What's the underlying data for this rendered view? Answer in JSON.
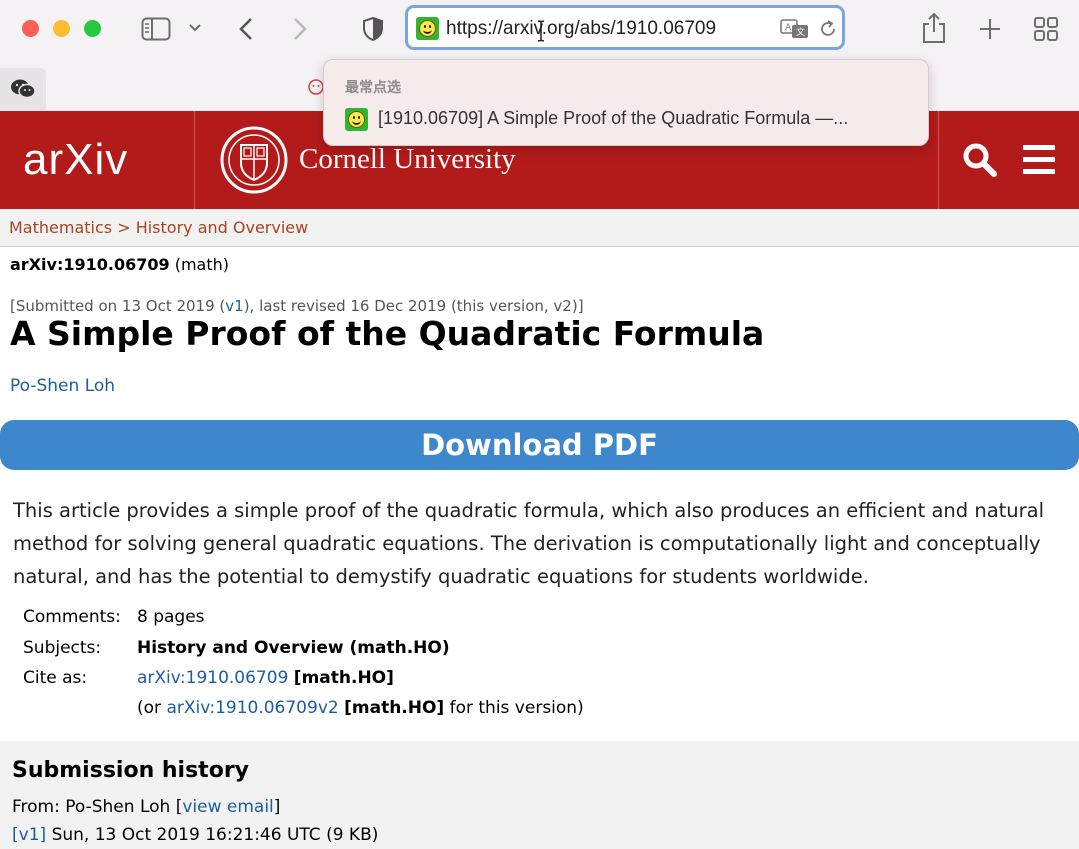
{
  "browser": {
    "url": "https://arxiv.org/abs/1910.06709",
    "dropdown_header": "最常点选",
    "dropdown_item": "[1910.06709] A Simple Proof of the Quadratic Formula —..."
  },
  "header": {
    "logo": "arXiv",
    "university": "Cornell University"
  },
  "breadcrumb": {
    "category": "Mathematics",
    "separator": ">",
    "subcategory": "History and Overview"
  },
  "paper": {
    "id": "arXiv:1910.06709",
    "id_suffix": "(math)",
    "submitted_prefix": "[Submitted on 13 Oct 2019 (",
    "submitted_v1": "v1",
    "submitted_suffix": "), last revised 16 Dec 2019 (this version, v2)]",
    "title": "A Simple Proof of the Quadratic Formula",
    "author": "Po-Shen Loh",
    "download_label": "Download PDF",
    "abstract": "This article provides a simple proof of the quadratic formula, which also produces an efficient and natural method for solving general quadratic equations. The derivation is computationally light and conceptually natural, and has the potential to demystify quadratic equations for students worldwide."
  },
  "metadata": {
    "comments_label": "Comments:",
    "comments_value": "8 pages",
    "subjects_label": "Subjects:",
    "subjects_value": "History and Overview (math.HO)",
    "cite_label": "Cite as:",
    "cite_link": "arXiv:1910.06709",
    "cite_tag": "[math.HO]",
    "cite2_prefix": "(or",
    "cite2_link": "arXiv:1910.06709v2",
    "cite2_tag": "[math.HO]",
    "cite2_suffix": "for this version)"
  },
  "submission_history": {
    "title": "Submission history",
    "from_prefix": "From: Po-Shen Loh [",
    "from_link": "view email",
    "from_suffix": "]",
    "v1_link": "[v1]",
    "v1_text": "Sun, 13 Oct 2019 16:21:46 UTC (9 KB)"
  },
  "colors": {
    "arxiv_red": "#b31b1b",
    "link_blue": "#1b5e9e",
    "button_blue": "#3f87cd",
    "breadcrumb_brown": "#a8431f"
  }
}
